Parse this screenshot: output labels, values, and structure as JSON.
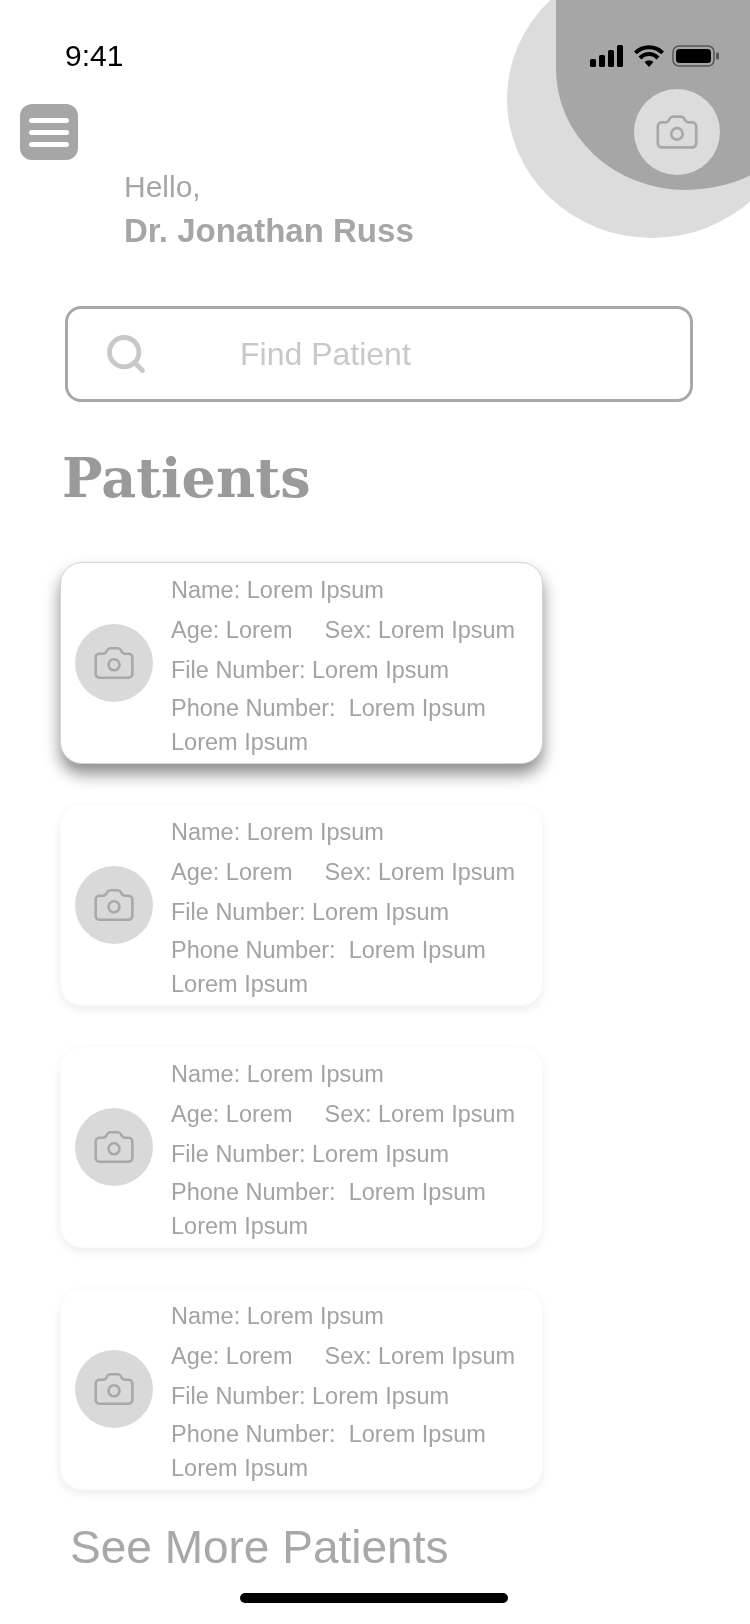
{
  "status_bar": {
    "time": "9:41"
  },
  "greeting": {
    "hello": "Hello,",
    "name": "Dr. Jonathan Russ"
  },
  "search": {
    "placeholder": "Find Patient"
  },
  "heading": "Patients",
  "patients": [
    {
      "selected": true,
      "name": "Name: Lorem Ipsum",
      "age": "Age: Lorem",
      "sex": "Sex: Lorem Ipsum",
      "file": "File Number: Lorem Ipsum",
      "phone": "Phone Number:  Lorem Ipsum Lorem Ipsum"
    },
    {
      "selected": false,
      "name": "Name: Lorem Ipsum",
      "age": "Age: Lorem",
      "sex": "Sex: Lorem Ipsum",
      "file": "File Number: Lorem Ipsum",
      "phone": "Phone Number:  Lorem Ipsum Lorem Ipsum"
    },
    {
      "selected": false,
      "name": "Name: Lorem Ipsum",
      "age": "Age: Lorem",
      "sex": "Sex: Lorem Ipsum",
      "file": "File Number: Lorem Ipsum",
      "phone": "Phone Number:  Lorem Ipsum Lorem Ipsum"
    },
    {
      "selected": false,
      "name": "Name: Lorem Ipsum",
      "age": "Age: Lorem",
      "sex": "Sex: Lorem Ipsum",
      "file": "File Number: Lorem Ipsum",
      "phone": "Phone Number:  Lorem Ipsum Lorem Ipsum"
    }
  ],
  "see_more": "See More Patients"
}
